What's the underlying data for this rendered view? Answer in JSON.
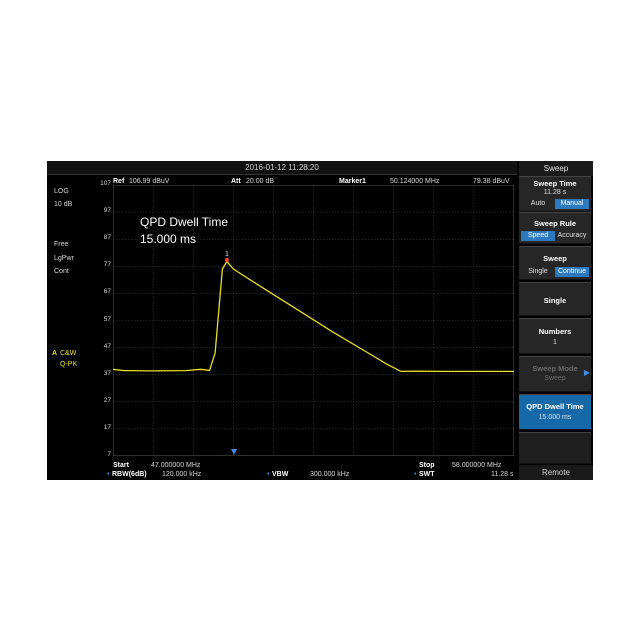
{
  "header": {
    "datetime": "2016-01-12  11:28:20"
  },
  "left_panel": {
    "scale_type": "LOG",
    "scale_div": "10 dB",
    "trigger": "Free",
    "trace_type": "LgPwr",
    "sweep_mode": "Cont",
    "detector_trace": "A",
    "detector_1": "C&W",
    "detector_2": "Q-PK"
  },
  "top_bar": {
    "ref_label": "Ref",
    "ref_value": "106.99 dBuV",
    "att_label": "Att",
    "att_value": "20.00 dB",
    "marker_label": "Marker1",
    "marker_freq": "50.124000 MHz",
    "marker_level": "79.38 dBuV"
  },
  "annotation": {
    "line1": "QPD Dwell Time",
    "line2": "15.000 ms"
  },
  "marker_tag": "1",
  "bottom_bar": {
    "start_label": "Start",
    "start_value": "47.000000 MHz",
    "stop_label": "Stop",
    "stop_value": "58.000000 MHz",
    "rbw_label": "RBW(6dB)",
    "rbw_value": "120.000 kHz",
    "vbw_label": "VBW",
    "vbw_value": "300.000 kHz",
    "swt_label": "SWT",
    "swt_value": "11.28 s"
  },
  "menu": {
    "title": "Sweep",
    "sweep_time": {
      "label": "Sweep Time",
      "value": "11.28 s",
      "opt_a": "Auto",
      "opt_b": "Manual",
      "selected": "Manual"
    },
    "sweep_rule": {
      "label": "Sweep Rule",
      "opt_a": "Speed",
      "opt_b": "Accuracy",
      "selected": "Speed"
    },
    "sweep": {
      "label": "Sweep",
      "opt_a": "Single",
      "opt_b": "Continue",
      "selected": "Continue"
    },
    "single": {
      "label": "Single"
    },
    "numbers": {
      "label": "Numbers",
      "value": "1"
    },
    "sweep_mode": {
      "label": "Sweep Mode",
      "value": "Sweep"
    },
    "qpd_dwell": {
      "label": "QPD Dwell Time",
      "value": "15.000 ms"
    },
    "remote": "Remote"
  },
  "colors": {
    "trace": "#e8e020",
    "marker": "#ff4020",
    "accent": "#1669a8"
  },
  "chart_data": {
    "type": "line",
    "title": "",
    "xlabel": "",
    "ylabel": "",
    "ylim": [
      7,
      107
    ],
    "xlim": [
      47,
      58
    ],
    "yticks": [
      "107",
      "97",
      "87",
      "77",
      "67",
      "57",
      "47",
      "37",
      "27",
      "17",
      "7"
    ],
    "grid": true,
    "series": [
      {
        "x": [
          47.0,
          47.3,
          48.0,
          49.0,
          49.4,
          49.65,
          49.8,
          50.0,
          50.124,
          50.3,
          51.0,
          52.0,
          53.0,
          54.0,
          54.5,
          54.9,
          55.3,
          56.0,
          57.0,
          58.0
        ],
        "y": [
          39,
          38.5,
          38.4,
          38.5,
          39,
          38.6,
          45,
          76,
          78.8,
          76,
          70,
          61.5,
          53,
          45,
          41,
          38.2,
          38.3,
          38.2,
          38.2,
          38.2
        ]
      }
    ],
    "marker": {
      "label": "1",
      "x": 50.124,
      "y": 79.38
    }
  }
}
